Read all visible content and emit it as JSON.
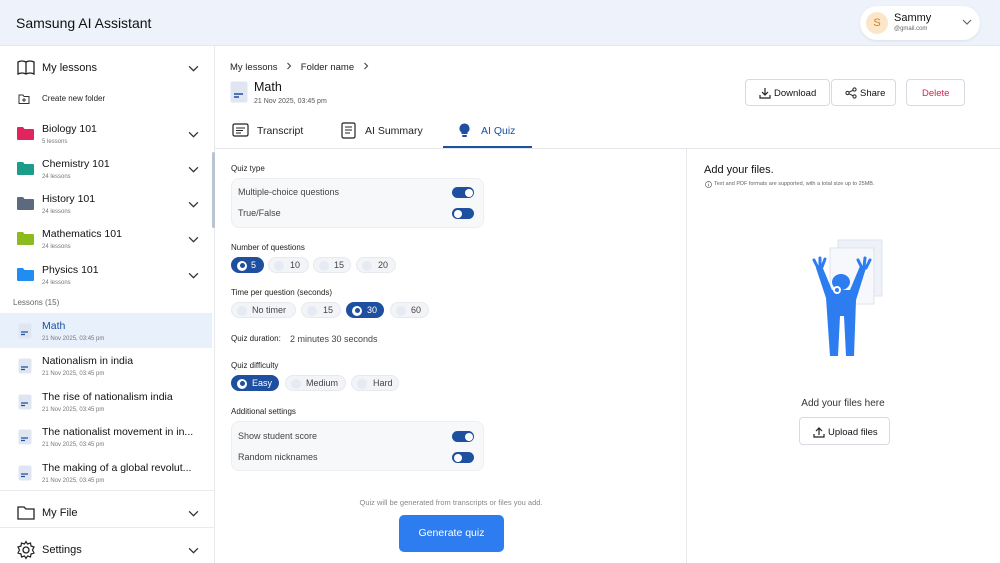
{
  "app": {
    "title": "Samsung AI Assistant"
  },
  "user": {
    "initial": "S",
    "name": "Sammy",
    "email": "@gmail.com"
  },
  "sidebar": {
    "my_lessons": "My lessons",
    "create_folder": "Create new folder",
    "folders": [
      {
        "name": "Biology 101",
        "count": "5 lessons",
        "color": "#e0245e"
      },
      {
        "name": "Chemistry 101",
        "count": "24 lessons",
        "color": "#1a9e8a"
      },
      {
        "name": "History 101",
        "count": "24 lessons",
        "color": "#5b6a7d"
      },
      {
        "name": "Mathematics 101",
        "count": "24 lessons",
        "color": "#8dbb1f"
      },
      {
        "name": "Physics 101",
        "count": "24 lessons",
        "color": "#1f8ef0"
      }
    ],
    "lessons_header": "Lessons (15)",
    "lessons": [
      {
        "title": "Math",
        "date": "21 Nov 2025, 03:45 pm"
      },
      {
        "title": "Nationalism in india",
        "date": "21 Nov 2025, 03:45 pm"
      },
      {
        "title": "The rise of nationalism india",
        "date": "21 Nov 2025, 03:45 pm"
      },
      {
        "title": "The nationalist movement in in...",
        "date": "21 Nov 2025, 03:45 pm"
      },
      {
        "title": "The making of a global revolut...",
        "date": "21 Nov 2025, 03:45 pm"
      }
    ],
    "my_file": "My File",
    "settings": "Settings"
  },
  "header": {
    "breadcrumb": [
      "My lessons",
      "Folder name"
    ],
    "doc_title": "Math",
    "doc_date": "21 Nov 2025, 03:45 pm",
    "download": "Download",
    "share": "Share",
    "delete": "Delete"
  },
  "tabs": [
    {
      "label": "Transcript"
    },
    {
      "label": "AI Summary"
    },
    {
      "label": "AI Quiz"
    }
  ],
  "quiz": {
    "type_label": "Quiz type",
    "types": [
      {
        "label": "Multiple-choice questions",
        "on": true
      },
      {
        "label": "True/False",
        "on": false
      }
    ],
    "num_label": "Number of questions",
    "num_options": [
      "5",
      "10",
      "15",
      "20"
    ],
    "num_selected": "5",
    "time_label": "Time per question (seconds)",
    "time_options": [
      "No timer",
      "15",
      "30",
      "60"
    ],
    "time_selected": "30",
    "duration_label": "Quiz duration:",
    "duration_value": "2 minutes 30 seconds",
    "difficulty_label": "Quiz difficulty",
    "difficulty_options": [
      "Easy",
      "Medium",
      "Hard"
    ],
    "difficulty_selected": "Easy",
    "additional_label": "Additional settings",
    "additional": [
      {
        "label": "Show student score",
        "on": true
      },
      {
        "label": "Random nicknames",
        "on": false
      }
    ],
    "hint": "Quiz will be generated from transcripts or files you add.",
    "generate": "Generate quiz"
  },
  "upload": {
    "title": "Add your files.",
    "hint": "Text and PDF formats are supported, with a total size up to 25MB.",
    "add_here": "Add your files here",
    "button": "Upload files"
  },
  "colors": {
    "accent": "#1f4f9f",
    "primary_button": "#2d7cf0",
    "delete": "#d6254a",
    "illustration": "#2d7cf0"
  }
}
